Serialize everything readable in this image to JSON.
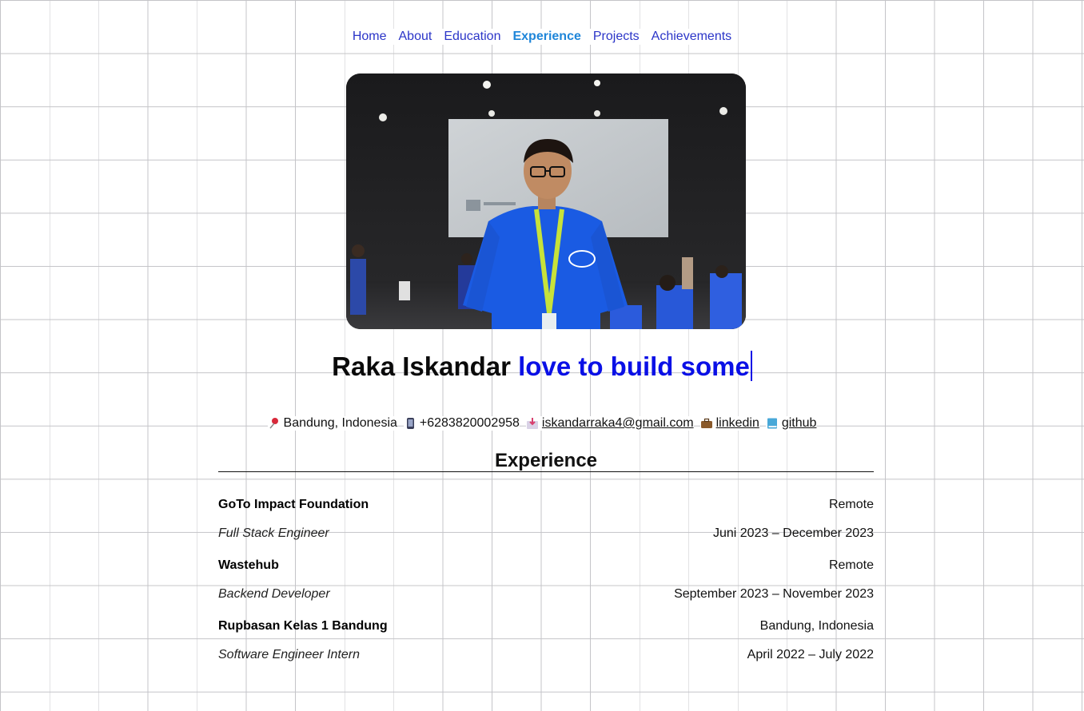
{
  "nav": {
    "items": [
      {
        "label": "Home",
        "active": false
      },
      {
        "label": "About",
        "active": false
      },
      {
        "label": "Education",
        "active": false
      },
      {
        "label": "Experience",
        "active": true
      },
      {
        "label": "Projects",
        "active": false
      },
      {
        "label": "Achievements",
        "active": false
      }
    ]
  },
  "hero": {
    "name": "Raka Iskandar",
    "typed_text": "love to build some",
    "photo_icon": "profile-photo"
  },
  "contacts": {
    "location": {
      "icon": "pushpin-icon",
      "text": "Bandung, Indonesia"
    },
    "phone": {
      "icon": "mobile-phone-icon",
      "text": "+6283820002958"
    },
    "email": {
      "icon": "inbox-icon",
      "text": "iskandarraka4@gmail.com"
    },
    "linkedin": {
      "icon": "briefcase-icon",
      "text": "linkedin"
    },
    "github": {
      "icon": "book-icon",
      "text": "github"
    }
  },
  "experience": {
    "title": "Experience",
    "items": [
      {
        "company": "GoTo Impact Foundation",
        "location": "Remote",
        "role": "Full Stack Engineer",
        "dates": "Juni 2023 – December 2023"
      },
      {
        "company": "Wastehub",
        "location": "Remote",
        "role": "Backend Developer",
        "dates": "September 2023 – November 2023"
      },
      {
        "company": "Rupbasan Kelas 1 Bandung",
        "location": "Bandung, Indonesia",
        "role": "Software Engineer Intern",
        "dates": "April 2022 – July 2022"
      }
    ]
  },
  "colors": {
    "nav_link": "#2b35c8",
    "nav_active": "#1f86d9",
    "typed_text": "#0a10e6",
    "grid": "#c4c4c8"
  }
}
